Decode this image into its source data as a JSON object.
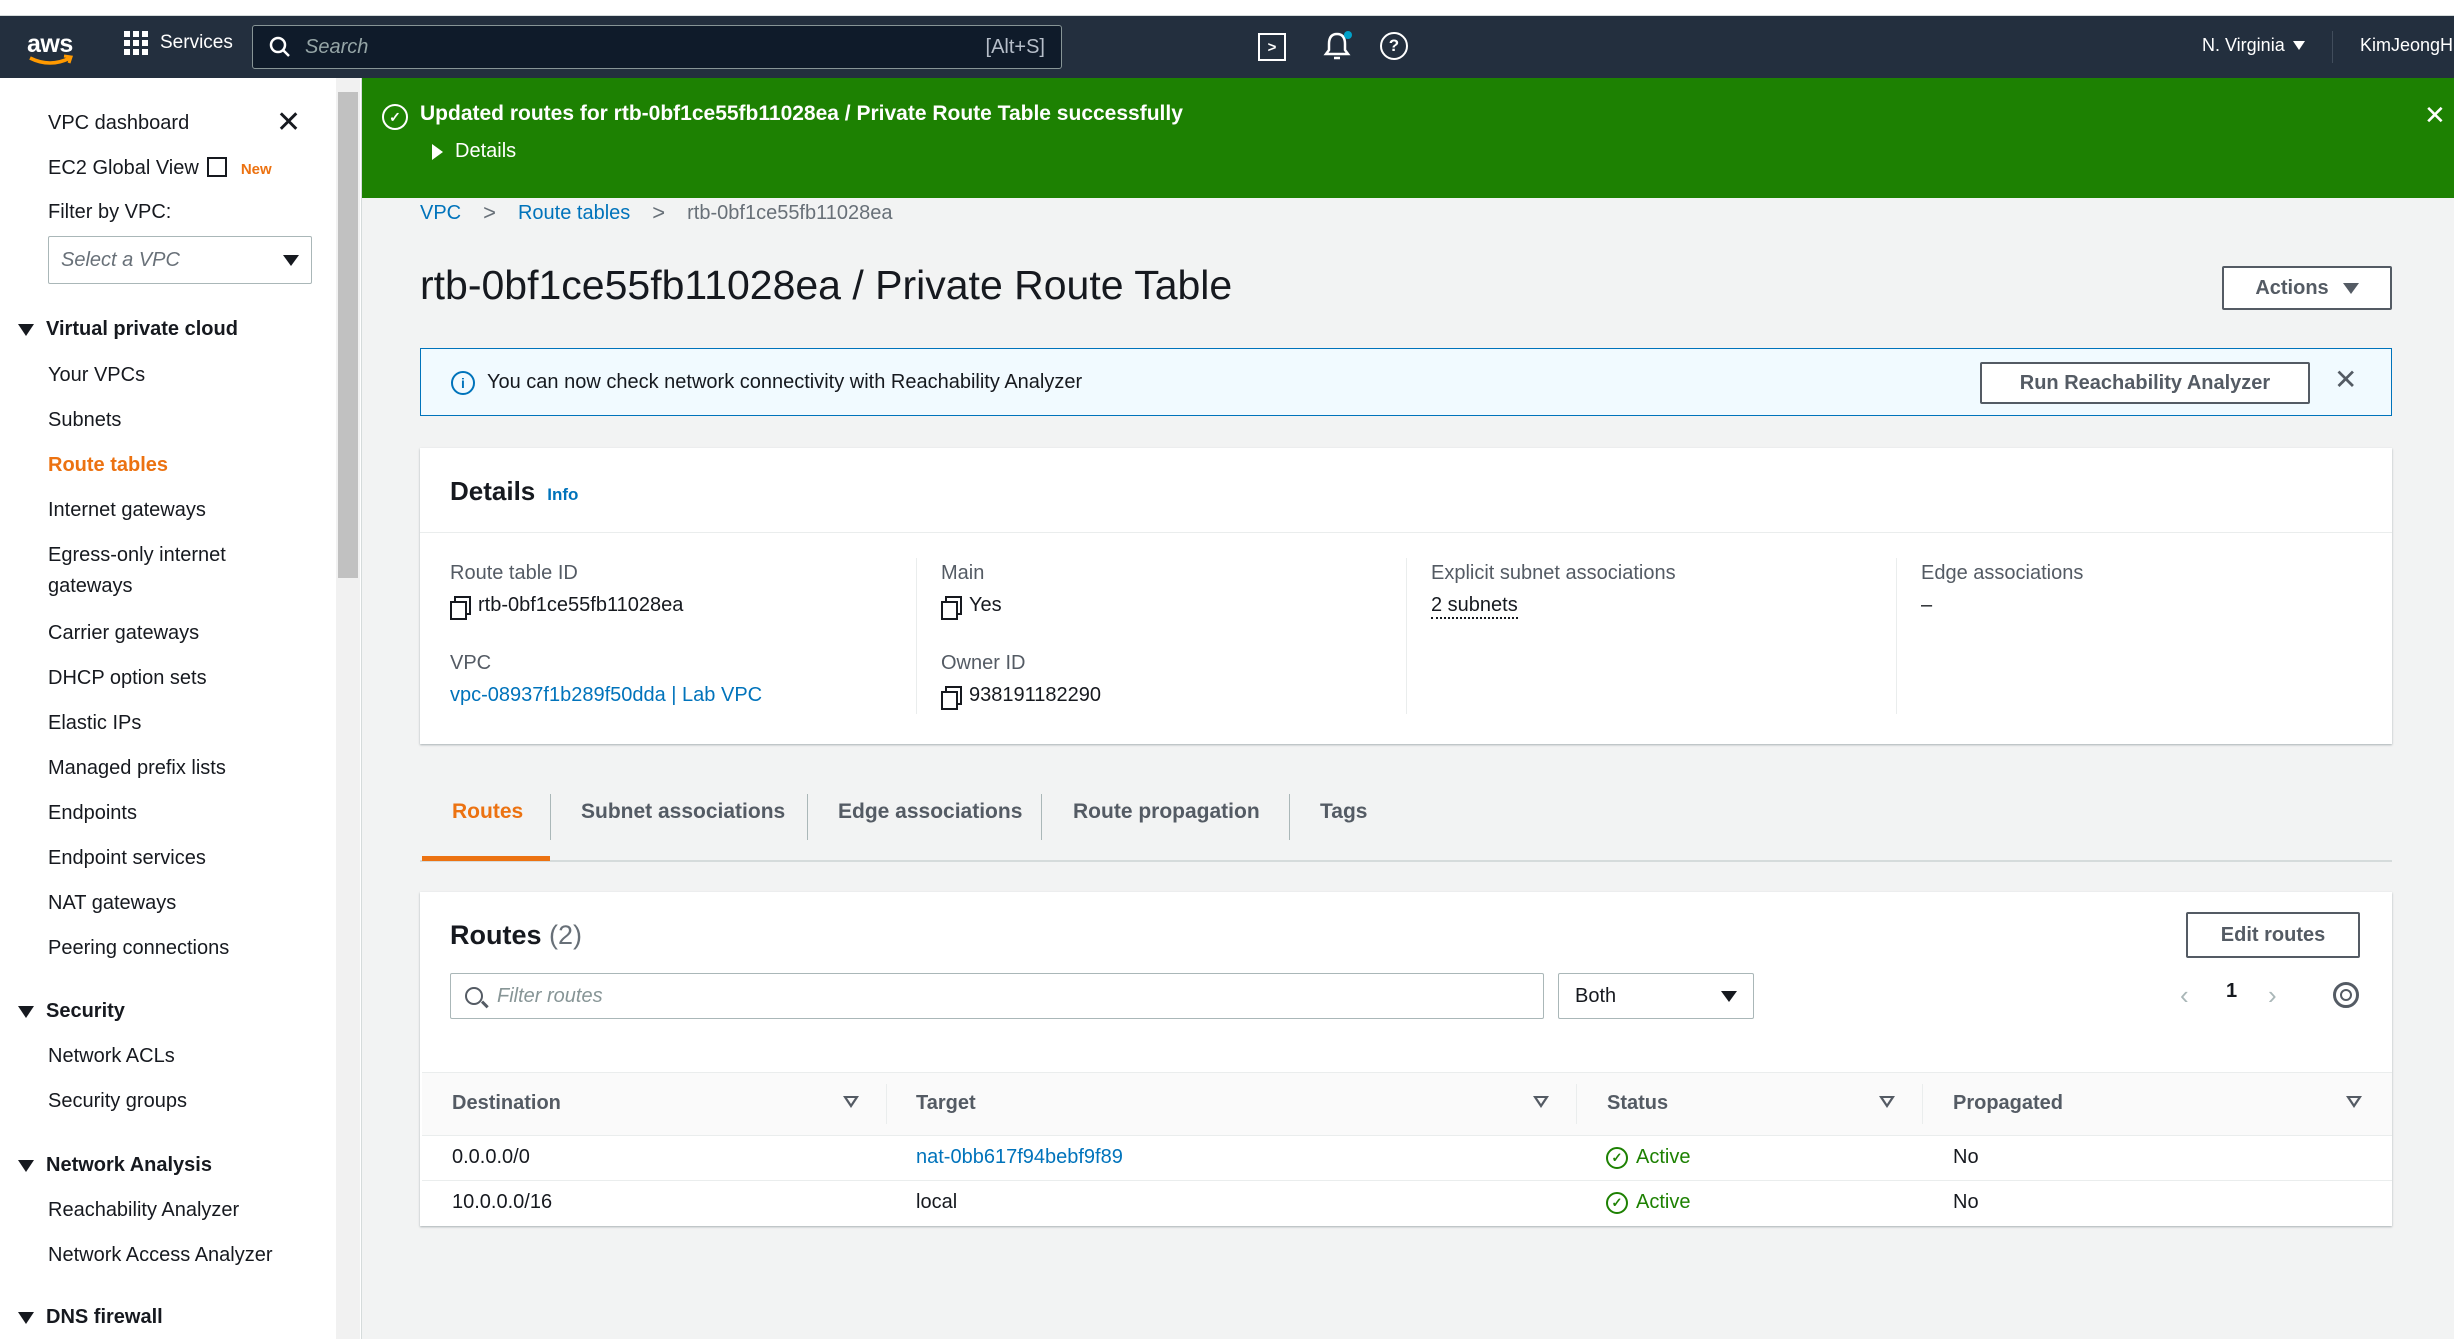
{
  "topnav": {
    "logo": "aws",
    "services_label": "Services",
    "search_placeholder": "Search",
    "search_shortcut": "[Alt+S]",
    "region": "N. Virginia",
    "user": "KimJeongH",
    "icons": [
      "cloudshell-icon",
      "bell-icon",
      "help-icon"
    ]
  },
  "sidebar": {
    "dashboard": "VPC dashboard",
    "ec2_global_view": "EC2 Global View",
    "new_badge": "New",
    "filter_label": "Filter by VPC:",
    "vpc_select_placeholder": "Select a VPC",
    "sections": [
      {
        "title": "Virtual private cloud",
        "items": [
          "Your VPCs",
          "Subnets",
          "Route tables",
          "Internet gateways",
          "Egress-only internet gateways",
          "Carrier gateways",
          "DHCP option sets",
          "Elastic IPs",
          "Managed prefix lists",
          "Endpoints",
          "Endpoint services",
          "NAT gateways",
          "Peering connections"
        ]
      },
      {
        "title": "Security",
        "items": [
          "Network ACLs",
          "Security groups"
        ]
      },
      {
        "title": "Network Analysis",
        "items": [
          "Reachability Analyzer",
          "Network Access Analyzer"
        ]
      },
      {
        "title": "DNS firewall",
        "items": []
      }
    ],
    "active_item": "Route tables",
    "egress_line1": "Egress-only internet",
    "egress_line2": "gateways"
  },
  "flash": {
    "message": "Updated routes for rtb-0bf1ce55fb11028ea / Private Route Table successfully",
    "details_label": "Details",
    "color": "#1d8102"
  },
  "breadcrumb": [
    "VPC",
    "Route tables",
    "rtb-0bf1ce55fb11028ea"
  ],
  "page": {
    "title": "rtb-0bf1ce55fb11028ea / Private Route Table",
    "actions_label": "Actions"
  },
  "info_banner": {
    "text": "You can now check network connectivity with Reachability Analyzer",
    "button_label": "Run Reachability Analyzer"
  },
  "details": {
    "heading": "Details",
    "info_link": "Info",
    "route_table_id_label": "Route table ID",
    "route_table_id": "rtb-0bf1ce55fb11028ea",
    "vpc_label": "VPC",
    "vpc_value": "vpc-08937f1b289f50dda | Lab VPC",
    "main_label": "Main",
    "main_value": "Yes",
    "owner_label": "Owner ID",
    "owner_value": "938191182290",
    "explicit_label": "Explicit subnet associations",
    "explicit_value": "2 subnets",
    "edge_label": "Edge associations",
    "edge_value": "–"
  },
  "tabs": [
    "Routes",
    "Subnet associations",
    "Edge associations",
    "Route propagation",
    "Tags"
  ],
  "routes": {
    "heading": "Routes",
    "count": "(2)",
    "edit_label": "Edit routes",
    "filter_placeholder": "Filter routes",
    "filter_select": "Both",
    "page_number": "1",
    "columns": [
      "Destination",
      "Target",
      "Status",
      "Propagated"
    ],
    "rows": [
      {
        "destination": "0.0.0.0/0",
        "target": "nat-0bb617f94bebf9f89",
        "status": "Active",
        "propagated": "No"
      },
      {
        "destination": "10.0.0.0/16",
        "target": "local",
        "status": "Active",
        "propagated": "No"
      }
    ]
  },
  "colors": {
    "accent": "#ec7211",
    "link": "#0073bb",
    "success": "#1d8102",
    "nav": "#232f3e"
  }
}
